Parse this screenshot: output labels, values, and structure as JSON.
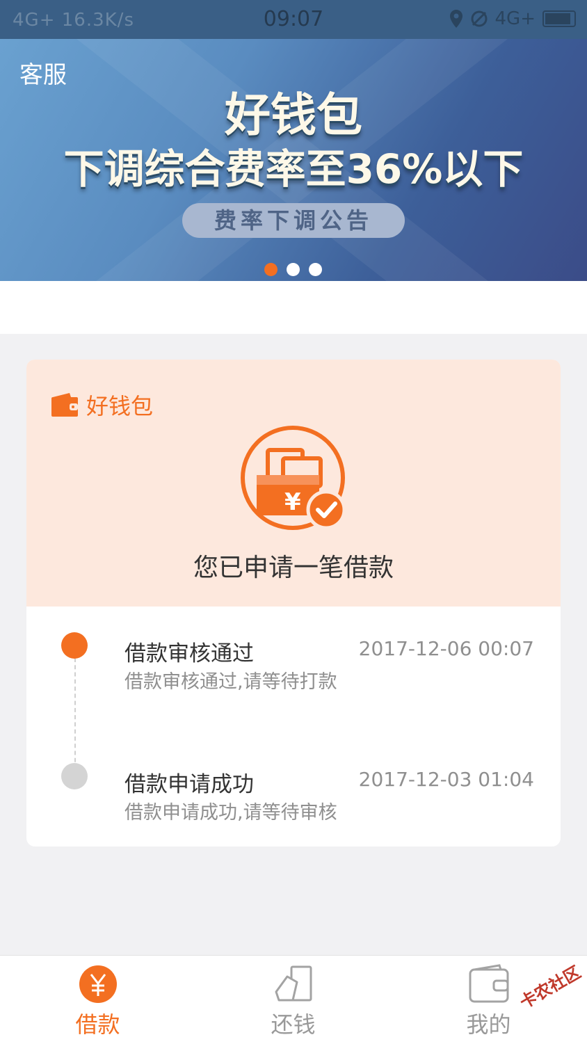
{
  "status_bar": {
    "left_text": "4G+ 16.3K/s",
    "time": "09:07",
    "right_text": "4G+"
  },
  "banner": {
    "customer_service": "客服",
    "title": "好钱包",
    "subtitle": "下调综合费率至36%以下",
    "button": "费率下调公告",
    "slide_count": 3,
    "active_slide": 1
  },
  "card": {
    "brand_label": "好钱包",
    "status_message": "您已申请一笔借款",
    "timeline": [
      {
        "title": "借款审核通过",
        "desc": "借款审核通过,请等待打款",
        "time": "2017-12-06 00:07",
        "state": "active"
      },
      {
        "title": "借款申请成功",
        "desc": "借款申请成功,请等待审核",
        "time": "2017-12-03 01:04",
        "state": "done"
      }
    ]
  },
  "nav": {
    "items": [
      {
        "label": "借款",
        "icon": "yen-circle-icon",
        "active": true
      },
      {
        "label": "还钱",
        "icon": "repay-icon",
        "active": false
      },
      {
        "label": "我的",
        "icon": "wallet-icon",
        "active": false
      }
    ]
  },
  "watermark": "卡农社区",
  "colors": {
    "accent": "#f36f21",
    "card_top": "#fde8dd",
    "inactive": "#d4d4d4"
  }
}
